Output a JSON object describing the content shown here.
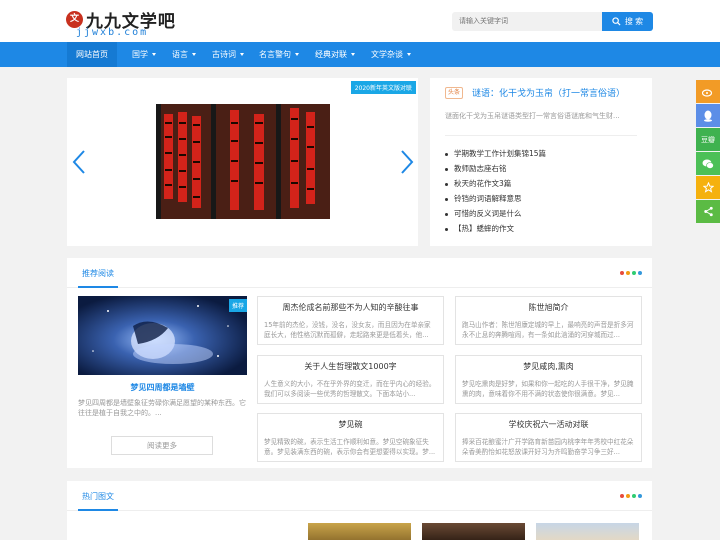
{
  "header": {
    "logo_badge": "文",
    "logo_text": "九九文学吧",
    "logo_sub": "jjwxb.com",
    "search_placeholder": "请输入关键字词",
    "search_button": "搜 索"
  },
  "nav": {
    "items": [
      {
        "label": "网站首页"
      },
      {
        "label": "国学"
      },
      {
        "label": "语言"
      },
      {
        "label": "古诗词"
      },
      {
        "label": "名言警句"
      },
      {
        "label": "经典对联"
      },
      {
        "label": "文学杂谈"
      }
    ]
  },
  "slider": {
    "tag": "2020新年英文版对联"
  },
  "right_panel": {
    "tag": "头条",
    "title": "谜语：化干戈为玉帛（打一常言俗语）",
    "desc": "谜面化干戈为玉帛谜语类型打一常言俗语谜底和气生财...",
    "list": [
      "学期教学工作计划集锦15篇",
      "教师励志座右铭",
      "秋天的花作文3篇",
      "铃铛的词语解释意思",
      "可惜的反义词是什么",
      "【热】蟋蟀的作文"
    ]
  },
  "recommend": {
    "title": "推荐阅读",
    "feature": {
      "tag": "推荐",
      "title": "梦见四周都是墙壁",
      "desc": "梦见四周都是墙壁象征劳碌你满足愿望的某种东西。它往往是植于自我之中的。..."
    },
    "more": "阅读更多",
    "cards": [
      {
        "title": "周杰伦成名前那些不为人知的辛酸往事",
        "desc": "15年前的杰伦，没钱，没名，没女友，而且因为在单亲家庭长大，他性格沉默而孤僻，走起路来更是低着头，他..."
      },
      {
        "title": "陈世旭简介",
        "desc": "跑马山作者：陈世旭康定城的早上，最响亮的声音是折多河永不止息的奔腾喧闹，有一条如此汹涌的河穿城而过..."
      },
      {
        "title": "关于人生哲理散文1000字",
        "desc": "人生意义的大小，不在乎外界的变迁，而在乎内心的经验。我们可以多阅读一些优秀的哲理散文。下面本站小..."
      },
      {
        "title": "梦见咸肉,熏肉",
        "desc": "梦见吃熏肉是好梦，如果和你一起吃的人手很干净，梦见腌熏的肉，意味着你不用不满的状态使你很满意。梦见..."
      },
      {
        "title": "梦见碗",
        "desc": "梦见精致的碗，表示生活工作顺利如意。梦见空碗象征失意。梦见装满东西的碗，表示你会有更想要得以实现。梦..."
      },
      {
        "title": "学校庆祝六一活动对联",
        "desc": "捧采百花酿蜜汁广开学路育新苗园内桃李年年秀校中红花朵朵香美酌怡如花怒放课开好习为齐鸣勤奋学习争三好..."
      }
    ]
  },
  "hot": {
    "title": "热门图文"
  },
  "colors": {
    "primary": "#1e88e5",
    "dots": [
      "#e74c3c",
      "#f39c12",
      "#2ecc71",
      "#3498db"
    ],
    "share": [
      "#f29b26",
      "#5c8ee7",
      "#3fb24f",
      "#4cc057",
      "#f5b10e",
      "#5bbb44"
    ]
  },
  "share_buttons": [
    {
      "icon": "weibo-icon"
    },
    {
      "icon": "qq-icon"
    },
    {
      "icon": "douban-icon",
      "label": "豆瓣"
    },
    {
      "icon": "wechat-icon"
    },
    {
      "icon": "star-icon"
    },
    {
      "icon": "share-icon"
    }
  ]
}
